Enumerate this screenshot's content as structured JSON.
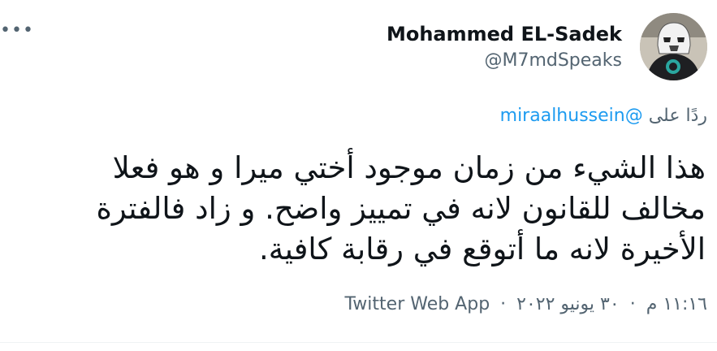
{
  "tweet": {
    "more_icon": "more-horizontal-icon",
    "author": {
      "display_name": "Mohammed EL-Sadek",
      "handle": "@M7mdSpeaks"
    },
    "reply": {
      "prefix": "ردًا على",
      "to_handle": "@miraalhussein"
    },
    "text": "هذا الشيء من زمان موجود أختي ميرا و هو فعلا مخالف للقانون لانه في تمييز واضح. و زاد فالفترة الأخيرة لانه ما أتوقع في رقابة كافية.",
    "meta": {
      "time": "١١:١٦ م",
      "separator": "·",
      "date": "٣٠ يونيو ٢٠٢٢",
      "app": "Twitter Web App"
    }
  },
  "colors": {
    "secondary_text": "#536471",
    "link": "#1d9bf0",
    "primary_text": "#0f1419"
  }
}
